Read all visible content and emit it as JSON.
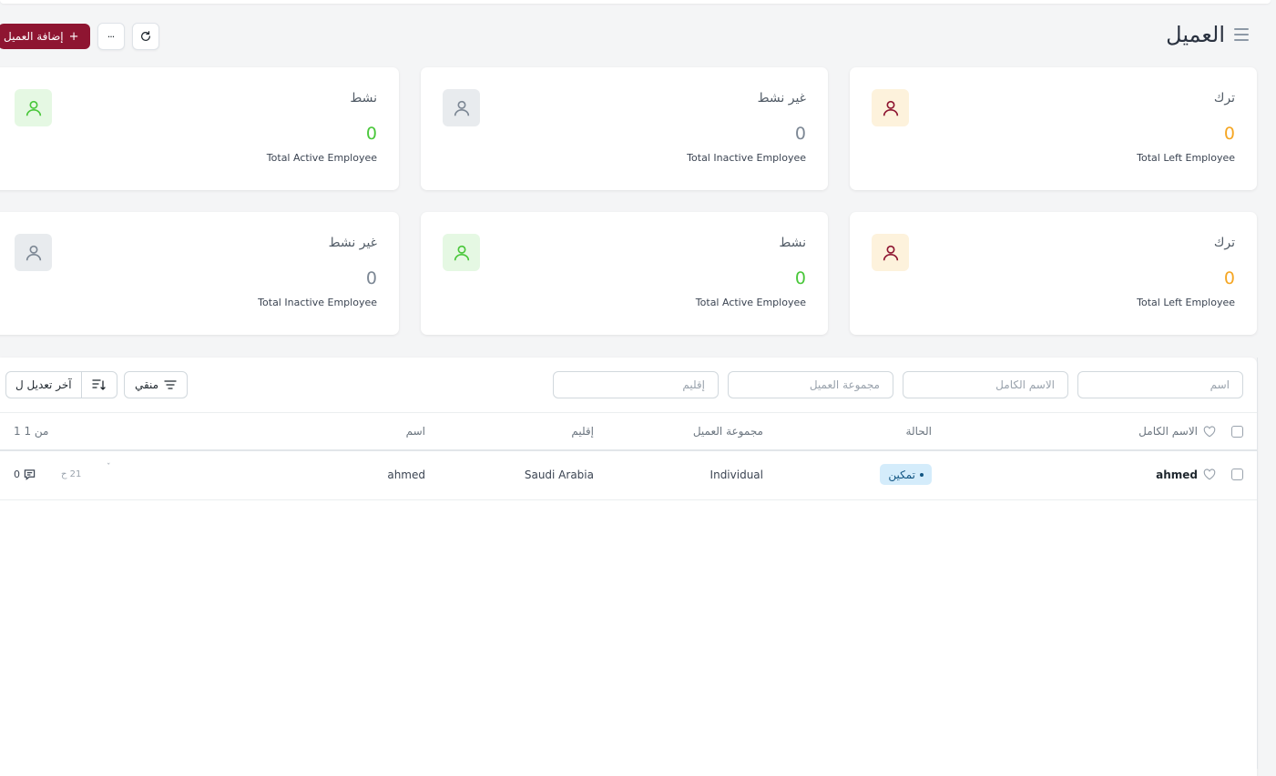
{
  "header": {
    "title": "العميل",
    "add_button_label": "إضافة العميل",
    "add_button_plus": "+",
    "more_label": "···"
  },
  "cards": [
    {
      "title": "ترك",
      "value": "0",
      "subtitle": "Total Left Employee",
      "value_color": "#f5a623",
      "icon": "user-icon",
      "icon_bg": "#fdf2dc",
      "icon_color": "#8e1531"
    },
    {
      "title": "غير نشط",
      "value": "0",
      "subtitle": "Total Inactive Employee",
      "value_color": "#7c8794",
      "icon": "user-icon",
      "icon_bg": "#e8ebee",
      "icon_color": "#7c8794"
    },
    {
      "title": "نشط",
      "value": "0",
      "subtitle": "Total Active Employee",
      "value_color": "#49c73a",
      "icon": "user-icon",
      "icon_bg": "#e5f8e3",
      "icon_color": "#49c73a"
    },
    {
      "title": "ترك",
      "value": "0",
      "subtitle": "Total Left Employee",
      "value_color": "#f5a623",
      "icon": "user-icon",
      "icon_bg": "#fdf2dc",
      "icon_color": "#8e1531"
    },
    {
      "title": "نشط",
      "value": "0",
      "subtitle": "Total Active Employee",
      "value_color": "#49c73a",
      "icon": "user-icon",
      "icon_bg": "#e5f8e3",
      "icon_color": "#49c73a"
    },
    {
      "title": "غير نشط",
      "value": "0",
      "subtitle": "Total Inactive Employee",
      "value_color": "#7c8794",
      "icon": "user-icon",
      "icon_bg": "#e8ebee",
      "icon_color": "#7c8794"
    }
  ],
  "filters": {
    "name_placeholder": "اسم",
    "full_name_placeholder": "الاسم الكامل",
    "customer_group_placeholder": "مجموعة العميل",
    "territory_placeholder": "إقليم",
    "filter_button_label": "منقي",
    "sort_label": "آخر تعديل ل"
  },
  "table": {
    "columns": {
      "full_name": "الاسم الكامل",
      "status": "الحالة",
      "customer_group": "مجموعة العميل",
      "territory": "إقليم",
      "name": "اسم",
      "count": "1 من 1"
    },
    "rows": [
      {
        "full_name": "ahmed",
        "status": "تمكين",
        "customer_group": "Individual",
        "territory": "Saudi Arabia",
        "name": "ahmed",
        "modified": "21 ح",
        "mark": "ˇ",
        "comments": "0"
      }
    ]
  }
}
